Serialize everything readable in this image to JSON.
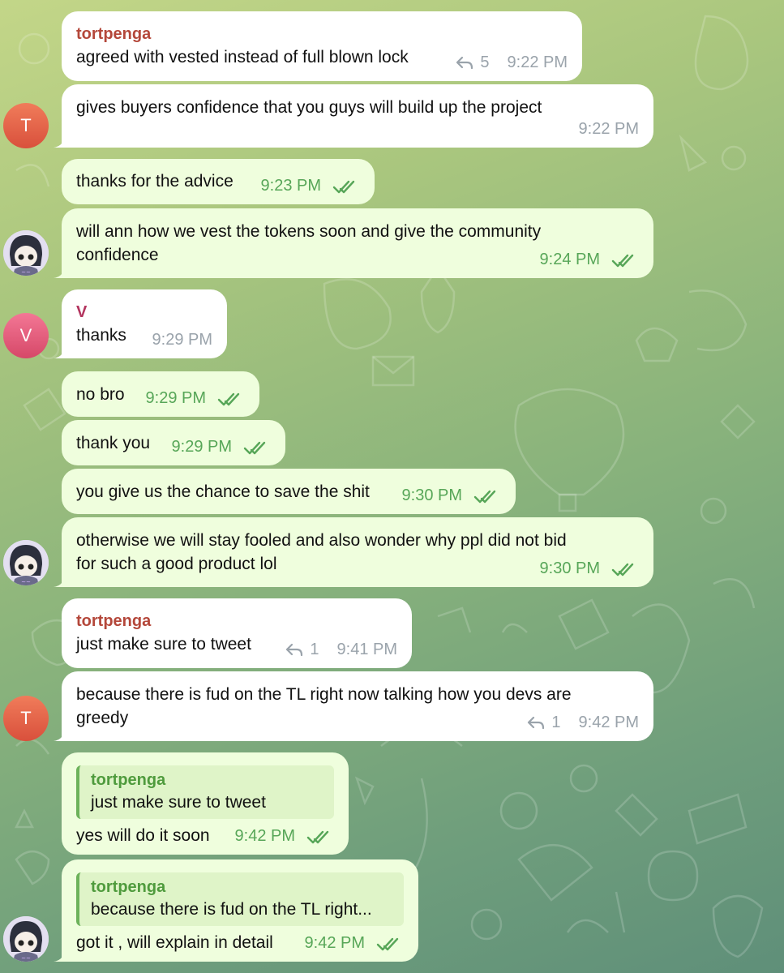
{
  "colors": {
    "incoming_bubble": "#ffffff",
    "outgoing_bubble": "#effedd",
    "sender_tortpenga": "#b4473a",
    "sender_v": "#b3345e",
    "outgoing_time": "#57a658",
    "incoming_time": "#9aa3ab",
    "quote_name": "#4f9b3d"
  },
  "icons": {
    "reply": "reply-arrow-icon",
    "read": "double-check-icon"
  },
  "messages": [
    {
      "sender": "tortpenga",
      "text": "agreed with vested instead of full blown lock",
      "replies": "5",
      "time": "9:22 PM"
    },
    {
      "text": "gives buyers confidence that you guys will build up the project",
      "time": "9:22 PM",
      "avatar": "T"
    },
    {
      "text": "thanks for the advice",
      "time": "9:23 PM"
    },
    {
      "text_line1": "will ann how we vest the tokens soon and give the community",
      "text_line2": "confidence",
      "time": "9:24 PM"
    },
    {
      "sender": "V",
      "text": "thanks",
      "time": "9:29 PM",
      "avatar": "V"
    },
    {
      "text": "no bro",
      "time": "9:29 PM"
    },
    {
      "text": "thank you",
      "time": "9:29 PM"
    },
    {
      "text": "you give us the chance to save the shit",
      "time": "9:30 PM"
    },
    {
      "text_line1": "otherwise we will stay fooled and also wonder why ppl did not bid",
      "text_line2": "for such a good product lol",
      "time": "9:30 PM"
    },
    {
      "sender": "tortpenga",
      "text": "just make sure to tweet",
      "replies": "1",
      "time": "9:41 PM"
    },
    {
      "text_line1": "because there is fud on the TL right now talking how you devs are",
      "text_line2": "greedy",
      "replies": "1",
      "time": "9:42 PM",
      "avatar": "T"
    },
    {
      "quote_name": "tortpenga",
      "quote_text": "just make sure to tweet",
      "text": "yes will do it soon",
      "time": "9:42 PM"
    },
    {
      "quote_name": "tortpenga",
      "quote_text": "because there is fud on the TL right...",
      "text": "got it , will explain in detail",
      "time": "9:42 PM"
    }
  ]
}
